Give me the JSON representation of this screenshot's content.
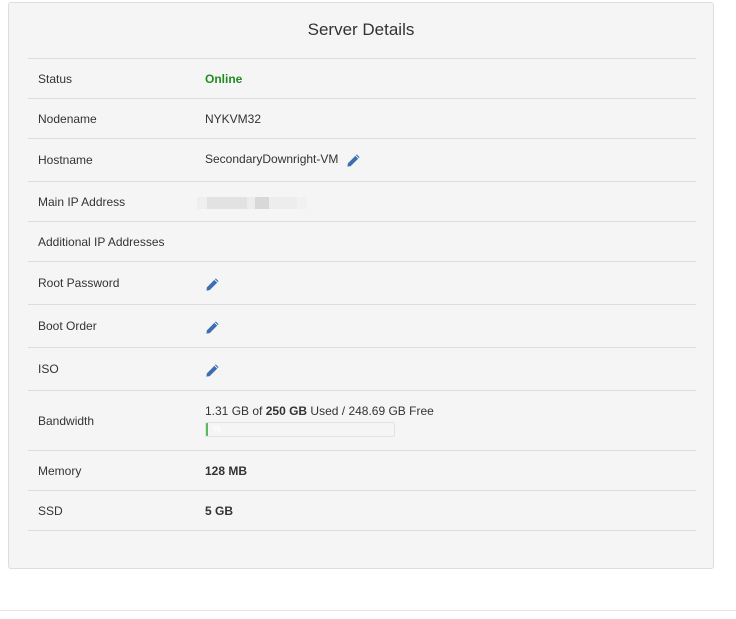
{
  "panel": {
    "title": "Server Details"
  },
  "rows": {
    "status": {
      "label": "Status",
      "value": "Online"
    },
    "nodename": {
      "label": "Nodename",
      "value": "NYKVM32"
    },
    "hostname": {
      "label": "Hostname",
      "value": "SecondaryDownright-VM"
    },
    "main_ip": {
      "label": "Main IP Address"
    },
    "additional_ip": {
      "label": "Additional IP Addresses"
    },
    "root_password": {
      "label": "Root Password"
    },
    "boot_order": {
      "label": "Boot Order"
    },
    "iso": {
      "label": "ISO"
    },
    "bandwidth": {
      "label": "Bandwidth",
      "used": "1.31 GB",
      "of_text": " of ",
      "total": "250 GB",
      "used_text": " Used / ",
      "free": "248.69 GB Free",
      "percent_label": "%",
      "percent": 0.52
    },
    "memory": {
      "label": "Memory",
      "value": "128 MB"
    },
    "ssd": {
      "label": "SSD",
      "value": "5 GB"
    }
  },
  "icons": {
    "edit": "pencil-icon"
  },
  "colors": {
    "status_online": "#228b22",
    "edit_icon": "#3d6fb0",
    "progress_fill": "#5cb85c"
  }
}
